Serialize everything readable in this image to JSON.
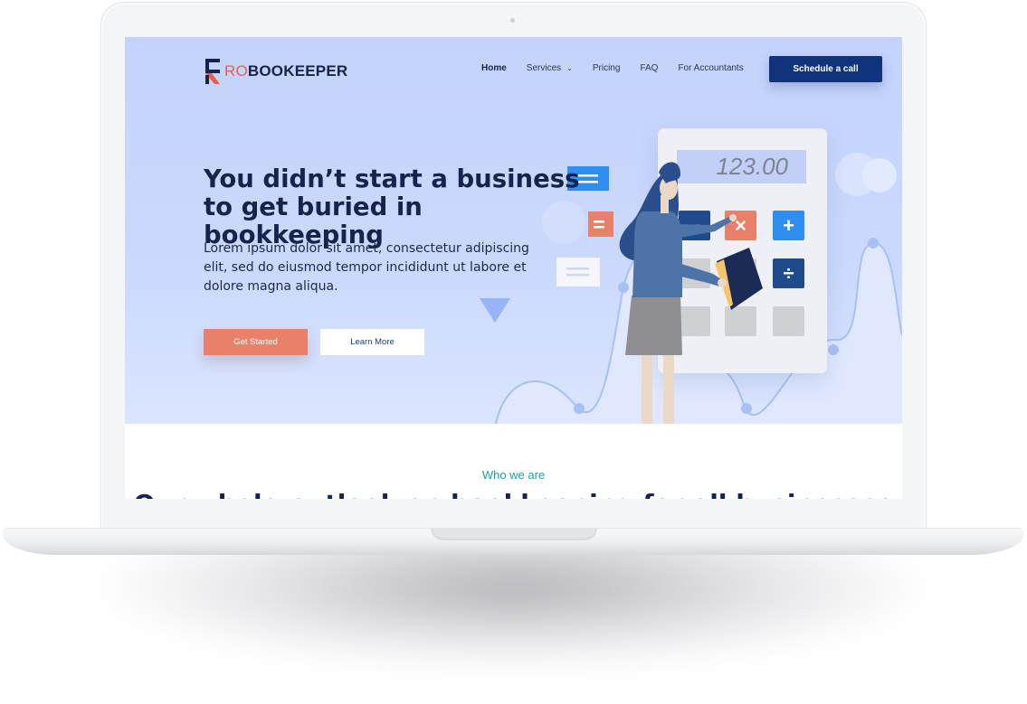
{
  "brand": {
    "prefix": "RO",
    "rest": "BOOKEEPER"
  },
  "nav": {
    "items": [
      {
        "label": "Home",
        "active": true
      },
      {
        "label": "Services",
        "dropdown": true
      },
      {
        "label": "Pricing"
      },
      {
        "label": "FAQ"
      },
      {
        "label": "For Accountants"
      }
    ],
    "cta": "Schedule a call"
  },
  "hero": {
    "headline_line1": "You didn’t start a business",
    "headline_line2": "to get buried in bookkeeping",
    "subtext": "Lorem ipsum dolor sit amet, consectetur adipiscing elit, sed do eiusmod tempor incididunt ut labore et dolore magna aliqua.",
    "primary_button": "Get Started",
    "secondary_button": "Learn More"
  },
  "calculator": {
    "display": "123.00",
    "keys": [
      "minus-icon",
      "multiply-icon",
      "plus-icon",
      "divide-icon"
    ]
  },
  "section": {
    "eyebrow": "Who we are",
    "heading": "Our whole-outlook on bookkeeping for all businesses"
  },
  "colors": {
    "hero_bg": "#c4d3fb",
    "navy": "#17234e",
    "cta_bg": "#0f347c",
    "coral": "#e8806a",
    "accent_blue": "#2f8ff0",
    "teal": "#1aa39e"
  }
}
